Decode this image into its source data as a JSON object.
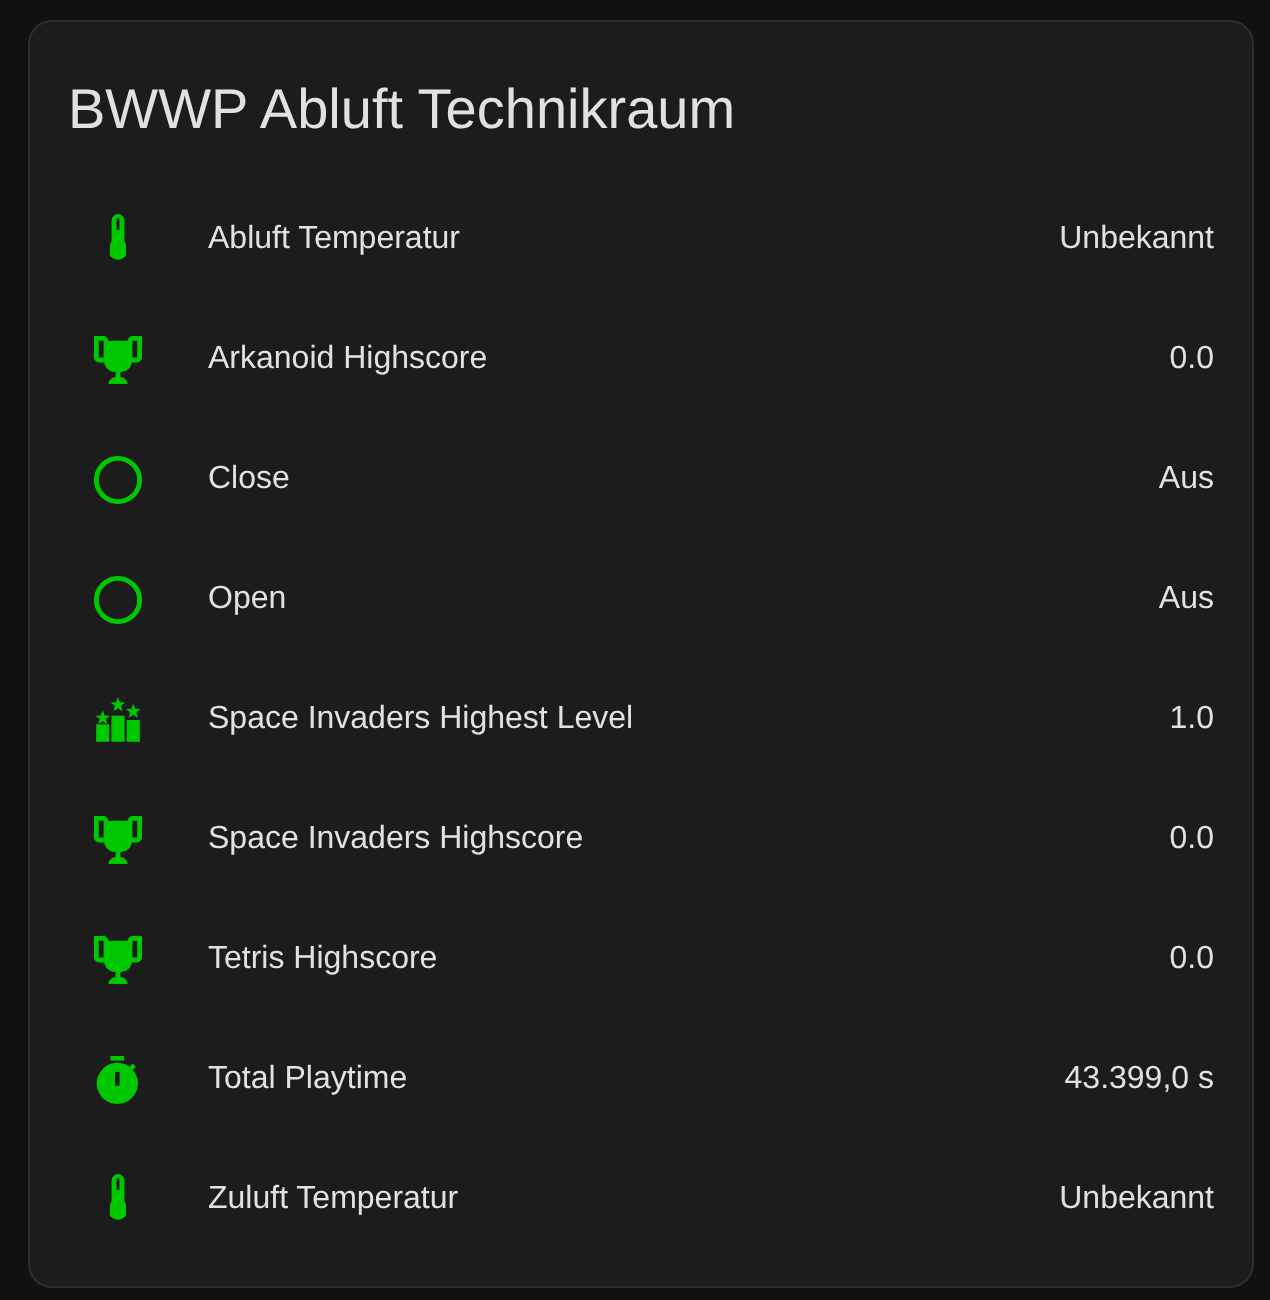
{
  "card": {
    "title": "BWWP Abluft Technikraum",
    "rows": [
      {
        "kind": "temperature",
        "label": "Abluft Temperatur",
        "value": "Unbekannt"
      },
      {
        "kind": "highscore",
        "label": "Arkanoid Highscore",
        "value": "0.0"
      },
      {
        "kind": "binary",
        "label": "Close",
        "value": "Aus"
      },
      {
        "kind": "binary",
        "label": "Open",
        "value": "Aus"
      },
      {
        "kind": "level",
        "label": "Space Invaders Highest Level",
        "value": "1.0"
      },
      {
        "kind": "highscore",
        "label": "Space Invaders Highscore",
        "value": "0.0"
      },
      {
        "kind": "highscore",
        "label": "Tetris Highscore",
        "value": "0.0"
      },
      {
        "kind": "duration",
        "label": "Total Playtime",
        "value": "43.399,0 s"
      },
      {
        "kind": "temperature",
        "label": "Zuluft Temperatur",
        "value": "Unbekannt"
      }
    ]
  }
}
